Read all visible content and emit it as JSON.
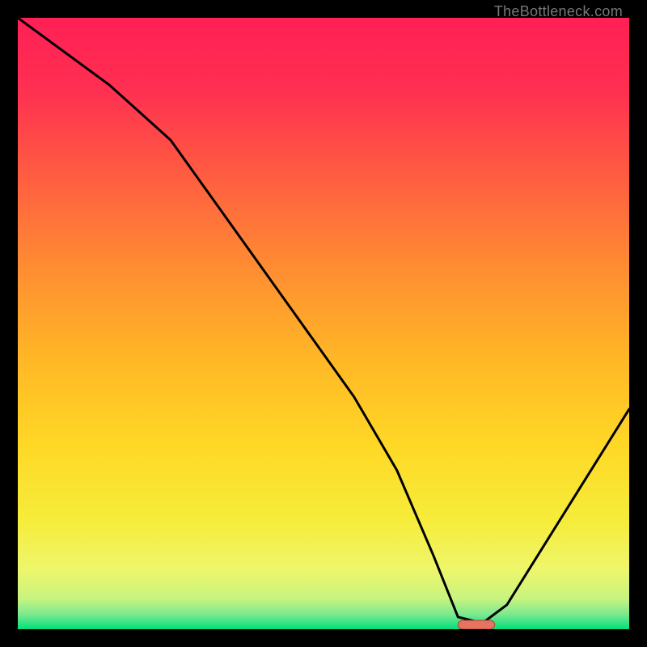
{
  "source_label": "TheBottleneck.com",
  "colors": {
    "gradient": [
      {
        "offset": 0.0,
        "color": "#ff1f55"
      },
      {
        "offset": 0.12,
        "color": "#ff3051"
      },
      {
        "offset": 0.25,
        "color": "#ff5a42"
      },
      {
        "offset": 0.4,
        "color": "#ff8a33"
      },
      {
        "offset": 0.55,
        "color": "#ffb526"
      },
      {
        "offset": 0.7,
        "color": "#ffd826"
      },
      {
        "offset": 0.82,
        "color": "#f6ec3a"
      },
      {
        "offset": 0.9,
        "color": "#eef66a"
      },
      {
        "offset": 0.95,
        "color": "#c8f47f"
      },
      {
        "offset": 0.975,
        "color": "#7ee98f"
      },
      {
        "offset": 1.0,
        "color": "#00e07c"
      }
    ],
    "curve": "#000000",
    "marker_fill": "#e6735f",
    "marker_stroke": "#a7463a"
  },
  "chart_data": {
    "type": "line",
    "title": "",
    "xlabel": "",
    "ylabel": "",
    "xlim": [
      0,
      100
    ],
    "ylim": [
      0,
      100
    ],
    "grid": false,
    "legend": false,
    "description": "Bottleneck curve: y is bottleneck severity (0 = no bottleneck, 100 = full bottleneck) vs x (hardware balance %). Curve descends from top-left, reaches a flat minimum near zero between x≈70 and x≈78, then rises again toward x=100.",
    "series": [
      {
        "name": "bottleneck_curve",
        "x": [
          0,
          15,
          25,
          35,
          45,
          55,
          62,
          68,
          72,
          76,
          80,
          85,
          90,
          95,
          100
        ],
        "values": [
          100,
          89,
          80,
          66,
          52,
          38,
          26,
          12,
          2,
          1,
          4,
          12,
          20,
          28,
          36
        ]
      }
    ],
    "marker": {
      "x_start": 72,
      "x_end": 78,
      "y": 0.8
    }
  }
}
